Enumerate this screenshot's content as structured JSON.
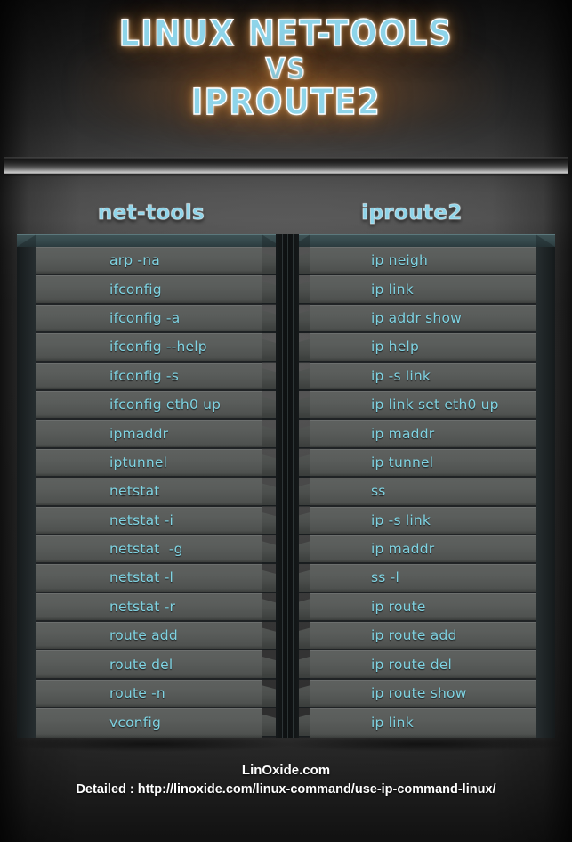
{
  "title": {
    "line1": "LINUX NET-TOOLS",
    "line2": "VS",
    "line3": "IPROUTE2"
  },
  "columns": {
    "left_header": "net-tools",
    "right_header": "iproute2"
  },
  "colors": {
    "accent_blue": "#8ed4e9",
    "row_text_blue": "#7fd3e2",
    "row_bg": "#5a5d5b",
    "cap_teal": "#36494c",
    "glow_orange": "#b4762d"
  },
  "rows": [
    {
      "net_tools": "arp -na",
      "iproute2": "ip neigh"
    },
    {
      "net_tools": "ifconfig",
      "iproute2": "ip link"
    },
    {
      "net_tools": "ifconfig -a",
      "iproute2": "ip addr show"
    },
    {
      "net_tools": "ifconfig --help",
      "iproute2": "ip help"
    },
    {
      "net_tools": "ifconfig -s",
      "iproute2": "ip -s link"
    },
    {
      "net_tools": "ifconfig eth0 up",
      "iproute2": "ip link set eth0 up"
    },
    {
      "net_tools": "ipmaddr",
      "iproute2": "ip maddr"
    },
    {
      "net_tools": "iptunnel",
      "iproute2": "ip tunnel"
    },
    {
      "net_tools": "netstat",
      "iproute2": "ss"
    },
    {
      "net_tools": "netstat -i",
      "iproute2": "ip -s link"
    },
    {
      "net_tools": "netstat  -g",
      "iproute2": "ip maddr"
    },
    {
      "net_tools": "netstat -l",
      "iproute2": "ss -l"
    },
    {
      "net_tools": "netstat -r",
      "iproute2": "ip route"
    },
    {
      "net_tools": "route add",
      "iproute2": "ip route add"
    },
    {
      "net_tools": "route del",
      "iproute2": "ip route del"
    },
    {
      "net_tools": "route -n",
      "iproute2": "ip route show"
    },
    {
      "net_tools": "vconfig",
      "iproute2": "ip link"
    }
  ],
  "footer": {
    "brand": "LinOxide.com",
    "url_line": "Detailed : http://linoxide.com/linux-command/use-ip-command-linux/"
  }
}
